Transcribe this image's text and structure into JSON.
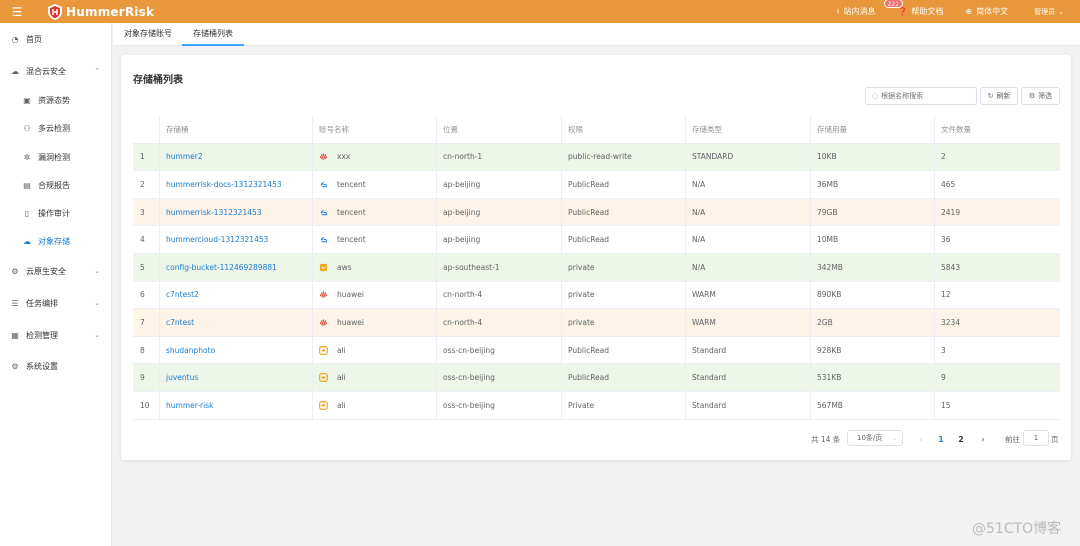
{
  "header": {
    "menu_icon": "hamburger-icon",
    "logo_text": "HummerRisk",
    "messages_label": "站内消息",
    "messages_badge": "222",
    "help_label": "帮助文档",
    "language_label": "简体中文",
    "user_label": "管理员",
    "accent_color": "#e8973a"
  },
  "sidebar": {
    "items": [
      {
        "label": "首页",
        "icon": "dashboard-icon"
      },
      {
        "label": "混合云安全",
        "icon": "cloud-icon"
      },
      {
        "label": "资源态势",
        "icon": "resource-icon"
      },
      {
        "label": "多云检测",
        "icon": "multi-cloud-icon"
      },
      {
        "label": "漏洞检测",
        "icon": "bug-icon"
      },
      {
        "label": "合规报告",
        "icon": "report-icon"
      },
      {
        "label": "操作审计",
        "icon": "audit-icon"
      },
      {
        "label": "对象存储",
        "icon": "storage-icon"
      },
      {
        "label": "云原生安全",
        "icon": "cloud-native-icon"
      },
      {
        "label": "任务编排",
        "icon": "task-icon"
      },
      {
        "label": "检测管理",
        "icon": "detect-icon"
      },
      {
        "label": "系统设置",
        "icon": "settings-icon"
      }
    ]
  },
  "tabs": [
    {
      "label": "对象存储账号"
    },
    {
      "label": "存储桶列表"
    }
  ],
  "main": {
    "title": "存储桶列表",
    "search_placeholder": "根据名称搜索",
    "refresh_label": "刷新",
    "filter_label": "筛选",
    "columns": [
      "存储桶",
      "账号名称",
      "位置",
      "权限",
      "存储类型",
      "存储用量",
      "文件数量"
    ],
    "rows": [
      {
        "index": "1",
        "bucket": "hummer2",
        "provider": "huawei",
        "account": "xxx",
        "location": "cn-north-1",
        "acl": "public-read-write",
        "storage_class": "STANDARD",
        "size": "10KB",
        "files": "2",
        "tint": "#eef6ea"
      },
      {
        "index": "2",
        "bucket": "hummerrisk-docs-1312321453",
        "provider": "tencent",
        "account": "tencent",
        "location": "ap-beijing",
        "acl": "PublicRead",
        "storage_class": "N/A",
        "size": "36MB",
        "files": "465",
        "tint": "#ffffff"
      },
      {
        "index": "3",
        "bucket": "hummerrisk-1312321453",
        "provider": "tencent",
        "account": "tencent",
        "location": "ap-beijing",
        "acl": "PublicRead",
        "storage_class": "N/A",
        "size": "79GB",
        "files": "2419",
        "tint": "#fdf4e7"
      },
      {
        "index": "4",
        "bucket": "hummercloud-1312321453",
        "provider": "tencent",
        "account": "tencent",
        "location": "ap-beijing",
        "acl": "PublicRead",
        "storage_class": "N/A",
        "size": "10MB",
        "files": "36",
        "tint": "#ffffff"
      },
      {
        "index": "5",
        "bucket": "config-bucket-112469289881",
        "provider": "aws",
        "account": "aws",
        "location": "ap-southeast-1",
        "acl": "private",
        "storage_class": "N/A",
        "size": "342MB",
        "files": "5843",
        "tint": "#eef6ea"
      },
      {
        "index": "6",
        "bucket": "c7ntest2",
        "provider": "huawei",
        "account": "huawei",
        "location": "cn-north-4",
        "acl": "private",
        "storage_class": "WARM",
        "size": "890KB",
        "files": "12",
        "tint": "#ffffff"
      },
      {
        "index": "7",
        "bucket": "c7ntest",
        "provider": "huawei",
        "account": "huawei",
        "location": "cn-north-4",
        "acl": "private",
        "storage_class": "WARM",
        "size": "2GB",
        "files": "3234",
        "tint": "#fdf4e7"
      },
      {
        "index": "8",
        "bucket": "shudanphoto",
        "provider": "ali",
        "account": "ali",
        "location": "oss-cn-beijing",
        "acl": "PublicRead",
        "storage_class": "Standard",
        "size": "928KB",
        "files": "3",
        "tint": "#ffffff"
      },
      {
        "index": "9",
        "bucket": "juventus",
        "provider": "ali",
        "account": "ali",
        "location": "oss-cn-beijing",
        "acl": "PublicRead",
        "storage_class": "Standard",
        "size": "531KB",
        "files": "9",
        "tint": "#eef6ea"
      },
      {
        "index": "10",
        "bucket": "hummer-risk",
        "provider": "ali",
        "account": "ali",
        "location": "oss-cn-beijing",
        "acl": "Private",
        "storage_class": "Standard",
        "size": "567MB",
        "files": "15",
        "tint": "#ffffff"
      }
    ]
  },
  "pagination": {
    "total_label": "共 14 条",
    "page_size": "10条/页",
    "prev": "‹",
    "pages": [
      "1",
      "2"
    ],
    "next": "›",
    "goto_label": "前往",
    "goto_value": "1",
    "page_unit": "页"
  },
  "watermark": "@51CTO博客"
}
